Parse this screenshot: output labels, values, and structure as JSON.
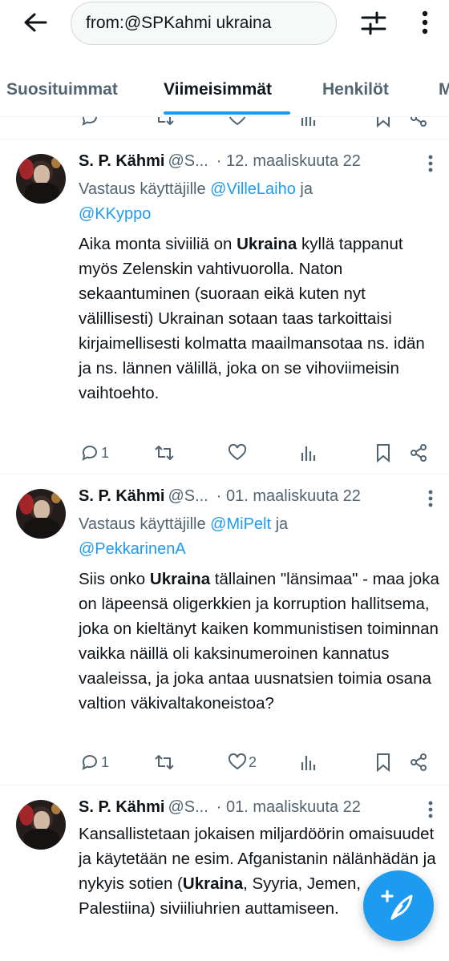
{
  "search": {
    "query": "from:@SPKahmi ukraina"
  },
  "icons": {
    "back": "arrow-left-icon",
    "filter": "sliders-icon",
    "more": "vertical-dots-icon",
    "compose": "feather-plus-icon"
  },
  "colors": {
    "accent": "#1d9bf0",
    "text": "#0f1419",
    "muted": "#536471"
  },
  "tabs": [
    {
      "label": "Suosituimmat",
      "active": false
    },
    {
      "label": "Viimeisimmät",
      "active": true
    },
    {
      "label": "Henkilöt",
      "active": false
    },
    {
      "label": "M",
      "active": false
    }
  ],
  "tweets": [
    {
      "author": "S. P. Kähmi",
      "handle": "@S...",
      "date": "· 12. maaliskuuta 22",
      "reply_prefix": "Vastaus käyttäjille ",
      "reply_mention_1": "@VilleLaiho",
      "reply_join": " ja",
      "reply_mention_2": "@KKyppo",
      "text_pre": "Aika monta siviiliä on ",
      "text_bold": "Ukraina",
      "text_post": " kyllä tappanut myös Zelenskin vahtivuorolla. Naton sekaantuminen (suoraan eikä kuten nyt välillisesti) Ukrainan sotaan taas tarkoittaisi kirjaimellisesti kolmatta maailmansotaa ns. idän ja ns. lännen välillä, joka on se vihoviimeisin vaihtoehto.",
      "replies": "1",
      "retweets": "",
      "likes": ""
    },
    {
      "author": "S. P. Kähmi",
      "handle": "@S...",
      "date": "· 01. maaliskuuta 22",
      "reply_prefix": "Vastaus käyttäjille ",
      "reply_mention_1": "@MiPelt",
      "reply_join": " ja",
      "reply_mention_2": "@PekkarinenA",
      "text_pre": "Siis onko ",
      "text_bold": "Ukraina",
      "text_post": " tällainen \"länsimaa\" - maa joka on läpeensä oligerkkien ja korruption hallitsema, joka on kieltänyt kaiken kommunistisen toiminnan vaikka näillä oli kaksinumeroinen kannatus vaaleissa, ja joka antaa uusnatsien toimia osana valtion väkivaltakoneistoa?",
      "replies": "1",
      "retweets": "",
      "likes": "2"
    },
    {
      "author": "S. P. Kähmi",
      "handle": "@S...",
      "date": "· 01. maaliskuuta 22",
      "text_pre": "Kansallistetaan jokaisen miljardöörin omaisuudet ja käytetään ne esim. Afganistanin nälänhädän ja nykyis sotien (",
      "text_bold": "Ukraina",
      "text_post": ", Syyria, Jemen, Palestiina) siviiliuhrien auttamiseen."
    }
  ]
}
